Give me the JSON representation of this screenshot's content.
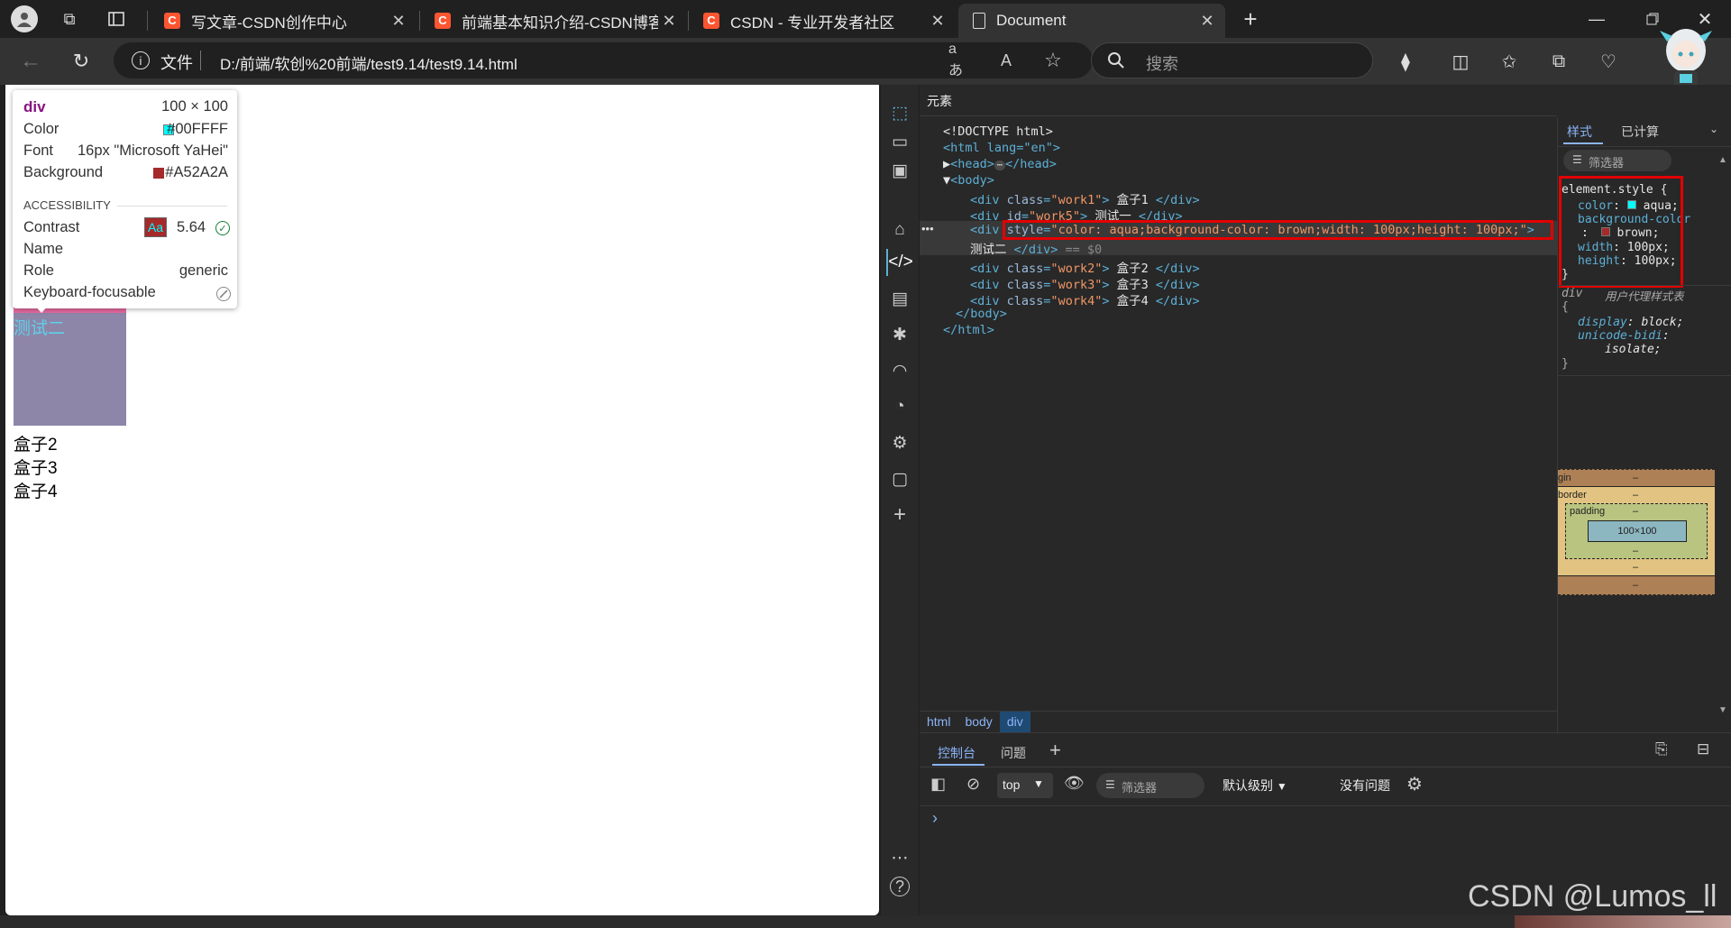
{
  "tabs": [
    {
      "title": "写文章-CSDN创作中心",
      "favicon": "C"
    },
    {
      "title": "前端基本知识介绍-CSDN博客",
      "favicon": "C"
    },
    {
      "title": "CSDN - 专业开发者社区",
      "favicon": "C"
    },
    {
      "title": "Document",
      "favicon": "page"
    }
  ],
  "address": {
    "scheme_label": "文件",
    "url": "D:/前端/软创%20前端/test9.14/test9.14.html"
  },
  "search": {
    "placeholder": "搜索"
  },
  "page": {
    "tooltip": {
      "tag": "div",
      "size": "100 × 100",
      "color_label": "Color",
      "color_value": "#00FFFF",
      "font_label": "Font",
      "font_value": "16px \"Microsoft YaHei\"",
      "bg_label": "Background",
      "bg_value": "#A52A2A",
      "section": "ACCESSIBILITY",
      "contrast_label": "Contrast",
      "contrast_badge": "Aa",
      "contrast_value": "5.64",
      "name_label": "Name",
      "role_label": "Role",
      "role_value": "generic",
      "focus_label": "Keyboard-focusable"
    },
    "highlighted_box_text": "测试二",
    "lines": [
      "盒子2",
      "盒子3",
      "盒子4"
    ]
  },
  "devtools": {
    "panel_title": "元素",
    "dom": {
      "doctype": "<!DOCTYPE html>",
      "html_open": "<html lang=\"en\">",
      "head": "<head>",
      "head_close": "</head>",
      "body_open": "<body>",
      "div1_class": "work1",
      "div1_text": " 盒子1 ",
      "div5_id": "work5",
      "div5_text": " 测试一 ",
      "selected_style": "color: aqua;background-color: brown;width: 100px;height: 100px;",
      "selected_text": "测试二 ",
      "selected_suffix": "== $0",
      "div2_class": "work2",
      "div2_text": " 盒子2 ",
      "div3_class": "work3",
      "div3_text": " 盒子3 ",
      "div4_class": "work4",
      "div4_text": " 盒子4 ",
      "body_close": "</body>",
      "html_close": "</html>"
    },
    "breadcrumb": [
      "html",
      "body",
      "div"
    ],
    "styles": {
      "tabs": [
        "样式",
        "已计算"
      ],
      "filter_placeholder": "筛选器",
      "element_style_selector": "element.style {",
      "rules": [
        {
          "prop": "color",
          "value": "aqua;"
        },
        {
          "prop": "background-color",
          "value": "brown;"
        },
        {
          "prop": "width",
          "value": "100px;"
        },
        {
          "prop": "height",
          "value": "100px;"
        }
      ],
      "ua_selector": "div",
      "ua_source": "用户代理样式表",
      "ua_rules": [
        {
          "prop": "display",
          "value": "block;"
        },
        {
          "prop": "unicode-bidi",
          "value": "isolate;"
        }
      ],
      "boxmodel": {
        "margin": "gin",
        "border": "border",
        "padding": "padding",
        "content": "100×100",
        "dash": "–"
      }
    },
    "console": {
      "tabs": [
        "控制台",
        "问题"
      ],
      "context": "top",
      "filter_placeholder": "筛选器",
      "level": "默认级别",
      "issues": "没有问题",
      "prompt": "›"
    }
  },
  "watermark": "CSDN @Lumos_ll",
  "colors": {
    "aqua": "#00FFFF",
    "brown": "#A52A2A",
    "highlight": "#e30000"
  }
}
